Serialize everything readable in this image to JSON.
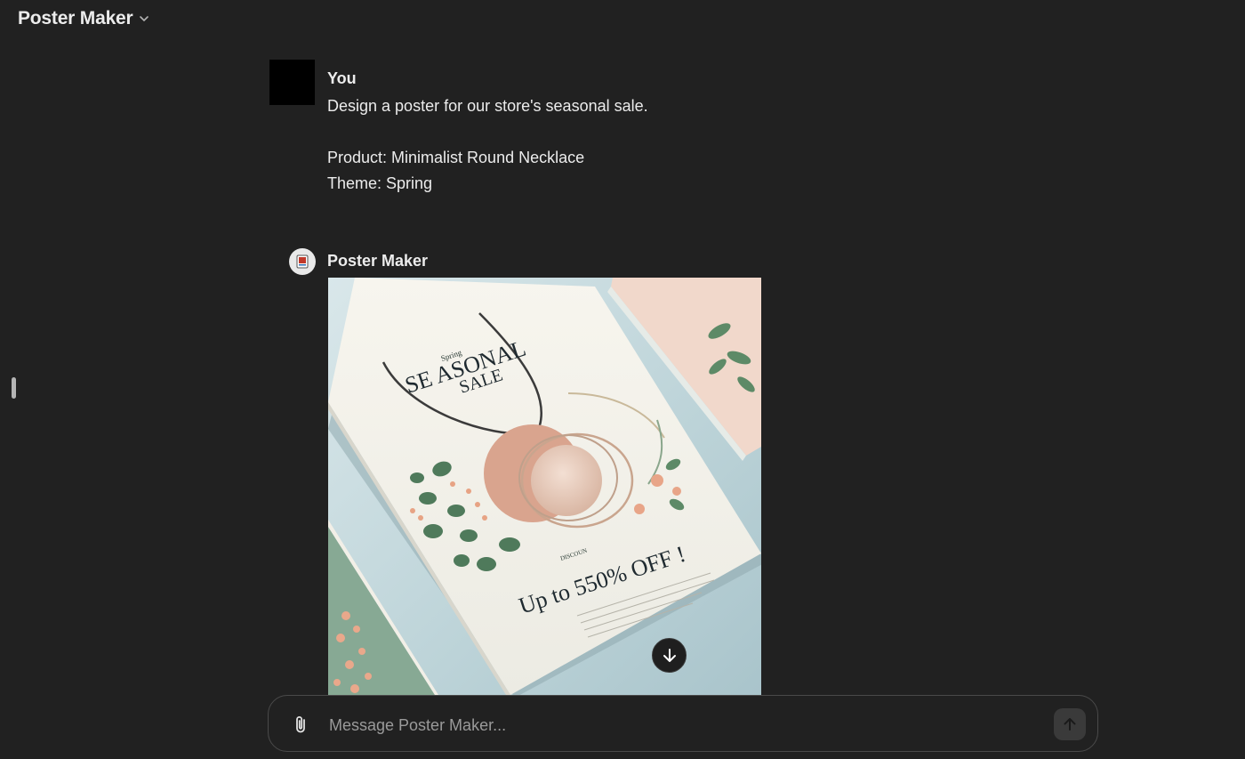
{
  "header": {
    "title": "Poster Maker",
    "dropdown_icon": "chevron-down-icon"
  },
  "conversation": {
    "user": {
      "name": "You",
      "message_lines": [
        "Design a poster for our store's seasonal sale.",
        "",
        "Product: Minimalist Round Necklace",
        "Theme: Spring"
      ]
    },
    "assistant": {
      "name": "Poster Maker",
      "avatar_icon": "poster-maker-avatar-icon",
      "image": {
        "subtitle": "Spring",
        "headline_1": "SE ASONAL",
        "headline_2": "SALE",
        "discount_small": "DISCOUN",
        "discount": "Up to 550% OFF !"
      }
    }
  },
  "composer": {
    "placeholder": "Message Poster Maker...",
    "value": "",
    "attach_icon": "paperclip-icon",
    "send_icon": "arrow-up-icon"
  },
  "scroll_button_icon": "arrow-down-icon",
  "colors": {
    "background": "#212121",
    "text": "#ececec",
    "composer_border": "#4a4a4a",
    "poster_peach": "#d7a48e",
    "poster_green": "#4f7a5b"
  }
}
